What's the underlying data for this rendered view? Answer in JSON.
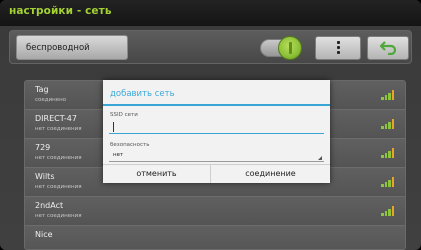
{
  "header": {
    "title": "настройки - сеть"
  },
  "toolbar": {
    "tab_label": "беспроводной",
    "toggle": "on"
  },
  "networks": [
    {
      "name": "Tag",
      "status": "соединено",
      "signal_bars": 4
    },
    {
      "name": "DIRECT-47",
      "status": "нет соединения",
      "signal_bars": 4
    },
    {
      "name": "729",
      "status": "нет соединения",
      "signal_bars": 4
    },
    {
      "name": "Wilts",
      "status": "нет соединения",
      "signal_bars": 4
    },
    {
      "name": "2ndAct",
      "status": "нет соединения",
      "signal_bars": 4
    },
    {
      "name": "Nice",
      "status": "",
      "signal_bars": 0
    }
  ],
  "dialog": {
    "title": "добавить сеть",
    "ssid_label": "SSID сети",
    "ssid_value": "",
    "security_label": "безопасность",
    "security_value": "нет",
    "cancel_label": "отменить",
    "connect_label": "соединение"
  },
  "colors": {
    "accent": "#3ba9d9",
    "title_green": "#a4d233",
    "signal_green": "#8cc63f",
    "signal_yellow": "#e8a424"
  }
}
